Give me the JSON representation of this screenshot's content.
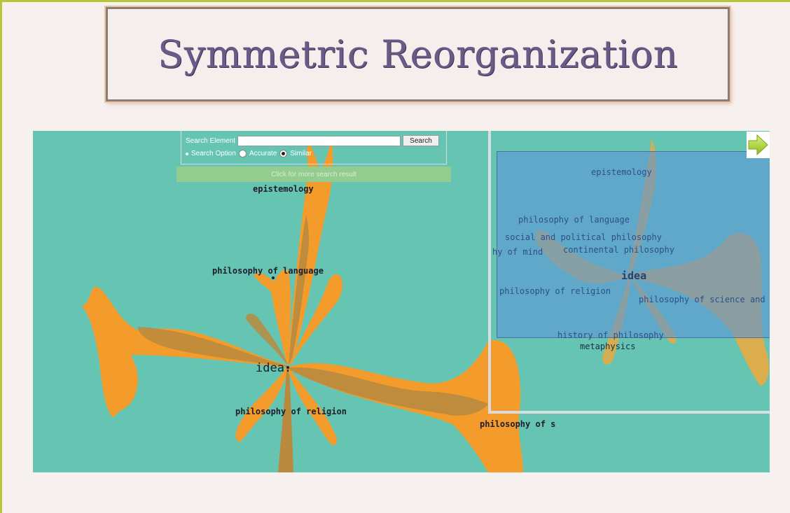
{
  "slide": {
    "title": "Symmetric Reorganization"
  },
  "search": {
    "label": "Search Element",
    "input_value": "",
    "button_label": "Search",
    "option_label": "Search Option",
    "option_accurate": "Accurate",
    "option_similar": "Similar",
    "selected_option": "Similar",
    "more_results": "Click for more search result"
  },
  "graph": {
    "center": "idea.",
    "nodes": [
      "epistemology",
      "philosophy of language",
      "philosophy of religion",
      "philosophy of s"
    ]
  },
  "minimap": {
    "labels": {
      "epistemology": "epistemology",
      "language": "philosophy of language",
      "social": "social and political philosophy",
      "mind": "hy of mind",
      "continental": "continental philosophy",
      "idea": "idea",
      "religion": "philosophy of religion",
      "science": "philosophy of science and t",
      "history": "history of philosophy",
      "metaphysics": "metaphysics"
    }
  },
  "colors": {
    "background": "#66c5b2",
    "branch_orange": "#f39c2b",
    "branch_brown": "#b98a3e",
    "viewport_blue": "#5a96d7",
    "title_purple": "#6b5a86"
  },
  "icons": {
    "next_slide": "arrow-right-icon"
  }
}
